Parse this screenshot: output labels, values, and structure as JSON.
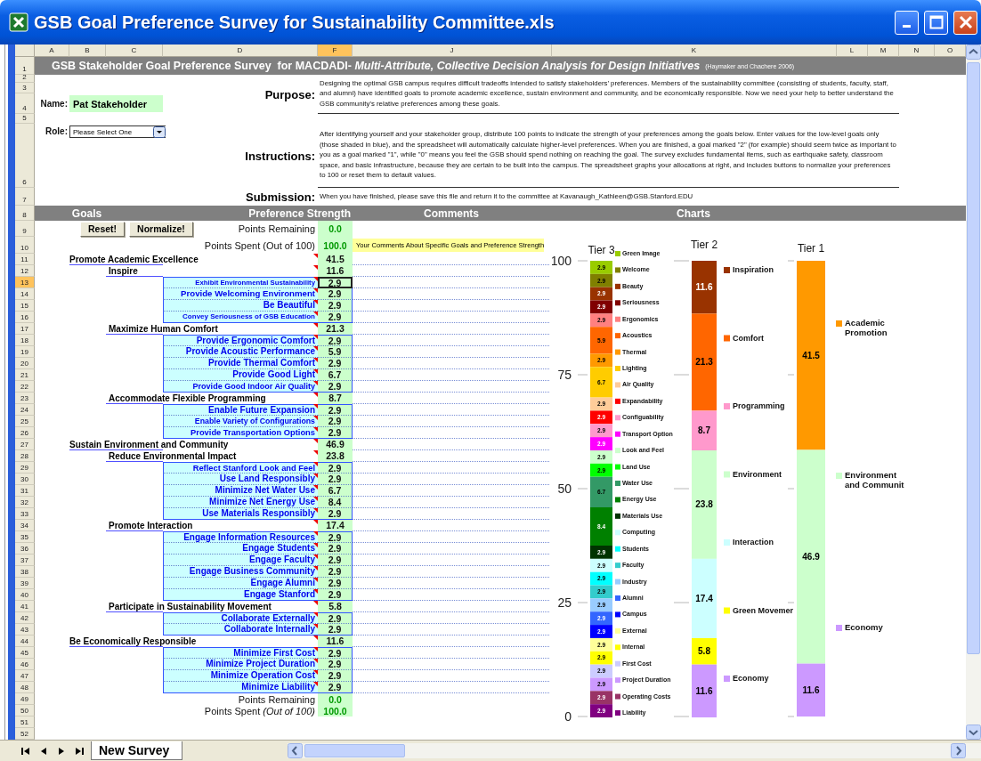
{
  "window": {
    "title": "GSB Goal Preference Survey for Sustainability Committee.xls"
  },
  "sheet": {
    "columns": [
      {
        "label": "A",
        "selected": false
      },
      {
        "label": "B",
        "selected": false
      },
      {
        "label": "C",
        "selected": false
      },
      {
        "label": "D",
        "selected": false
      },
      {
        "label": "F",
        "selected": true
      },
      {
        "label": "J",
        "selected": false
      },
      {
        "label": "K",
        "selected": false
      },
      {
        "label": "L",
        "selected": false
      },
      {
        "label": "M",
        "selected": false
      },
      {
        "label": "N",
        "selected": false
      },
      {
        "label": "O",
        "selected": false
      }
    ],
    "rows": [
      {
        "label": "1",
        "selected": false
      },
      {
        "label": "2",
        "selected": false
      },
      {
        "label": "3",
        "selected": false
      },
      {
        "label": "4",
        "selected": false
      },
      {
        "label": "5",
        "selected": false
      },
      {
        "label": "6",
        "selected": false
      },
      {
        "label": "7",
        "selected": false
      },
      {
        "label": "8",
        "selected": false
      },
      {
        "label": "9",
        "selected": false
      },
      {
        "label": "10",
        "selected": false
      },
      {
        "label": "11",
        "selected": false
      },
      {
        "label": "12",
        "selected": false
      },
      {
        "label": "13",
        "selected": true
      },
      {
        "label": "14",
        "selected": false
      },
      {
        "label": "15",
        "selected": false
      },
      {
        "label": "16",
        "selected": false
      },
      {
        "label": "17",
        "selected": false
      },
      {
        "label": "18",
        "selected": false
      },
      {
        "label": "19",
        "selected": false
      },
      {
        "label": "20",
        "selected": false
      },
      {
        "label": "21",
        "selected": false
      },
      {
        "label": "22",
        "selected": false
      },
      {
        "label": "23",
        "selected": false
      },
      {
        "label": "24",
        "selected": false
      },
      {
        "label": "25",
        "selected": false
      },
      {
        "label": "26",
        "selected": false
      },
      {
        "label": "27",
        "selected": false
      },
      {
        "label": "28",
        "selected": false
      },
      {
        "label": "29",
        "selected": false
      },
      {
        "label": "30",
        "selected": false
      },
      {
        "label": "31",
        "selected": false
      },
      {
        "label": "32",
        "selected": false
      },
      {
        "label": "33",
        "selected": false
      },
      {
        "label": "34",
        "selected": false
      },
      {
        "label": "35",
        "selected": false
      },
      {
        "label": "36",
        "selected": false
      },
      {
        "label": "37",
        "selected": false
      },
      {
        "label": "38",
        "selected": false
      },
      {
        "label": "39",
        "selected": false
      },
      {
        "label": "40",
        "selected": false
      },
      {
        "label": "41",
        "selected": false
      },
      {
        "label": "42",
        "selected": false
      },
      {
        "label": "43",
        "selected": false
      },
      {
        "label": "44",
        "selected": false
      },
      {
        "label": "45",
        "selected": false
      },
      {
        "label": "46",
        "selected": false
      },
      {
        "label": "47",
        "selected": false
      },
      {
        "label": "48",
        "selected": false
      },
      {
        "label": "49",
        "selected": false
      },
      {
        "label": "50",
        "selected": false
      },
      {
        "label": "51",
        "selected": false
      },
      {
        "label": "52",
        "selected": false
      }
    ],
    "tabs": [
      {
        "label": "New Survey",
        "selected": true
      }
    ]
  },
  "banner": {
    "title": "GSB Stakeholder Goal Preference Survey  for MACDADI- *Multi-Attribute, Collective Decision Analysis for Design Initiatives*",
    "citation": "(Haymaker and Chachere 2006)"
  },
  "name_field": {
    "label": "Name:",
    "value": "Pat Stakeholder"
  },
  "role_field": {
    "label": "Role:",
    "value": "Please Select One"
  },
  "intro": [
    {
      "label": "Purpose:",
      "text": "Designing the optimal GSB campus requires difficult tradeoffs intended to satisfy stakeholders’ preferences. Members of the sustainability committee (consisting of students, faculty, staff, and alumni) have identified goals to promote academic excellence, sustain environment and community, and be economically responsible. Now we need your help to better understand the GSB community’s relative preferences among these goals."
    },
    {
      "label": "Instructions:",
      "text": "After identifying yourself and your stakeholder group, distribute 100 points to indicate the strength of your preferences among the goals below. Enter values for the low-level goals only (those shaded in blue), and the spreadsheet will automatically calculate higher-level preferences. When you are finished, a goal marked \"2\" (for example) should seem twice as important to you as a goal marked \"1\", while \"0\" means you feel the GSB should spend nothing on reaching the goal. The survey excludes fundamental items, such as earthquake safety, classroom space, and basic infrastructure, because they are certain to be built into the campus. The spreadsheet graphs your allocations at right, and includes buttons to normalize your preferences to 100 or reset them to default values."
    },
    {
      "label": "Submission:",
      "text": "When you have finished, please save this file and return it to the committee at Kavanaugh_Kathleen@GSB.Stanford.EDU"
    }
  ],
  "section_headers": [
    "Goals",
    "Preference Strength",
    "Comments",
    "Charts"
  ],
  "buttons": [
    "Reset!",
    "Normalize!"
  ],
  "totals_top": [
    {
      "label": "Points Remaining",
      "value": "0.0"
    },
    {
      "label": "Points Spent (Out of 100)",
      "value": "100.0"
    }
  ],
  "comment_header": "Your Comments About Specific Goals and Preference Strength",
  "goals": [
    {
      "name": "Promote Academic Excellence",
      "value": "41.5",
      "children": [
        {
          "name": "Inspire",
          "value": "11.6",
          "children": [
            {
              "name": "Exhibit Environmental Sustainability",
              "value": "2.9",
              "selected": true
            },
            {
              "name": "Provide Welcoming Environment",
              "value": "2.9",
              "selected": false
            },
            {
              "name": "Be Beautiful",
              "value": "2.9",
              "selected": false
            },
            {
              "name": "Convey Seriousness of GSB Education",
              "value": "2.9",
              "selected": false
            }
          ]
        },
        {
          "name": "Maximize Human Comfort",
          "value": "21.3",
          "children": [
            {
              "name": "Provide Ergonomic Comfort",
              "value": "2.9",
              "selected": false
            },
            {
              "name": "Provide Acoustic Performance",
              "value": "5.9",
              "selected": false
            },
            {
              "name": "Provide Thermal Comfort",
              "value": "2.9",
              "selected": false
            },
            {
              "name": "Provide Good Light",
              "value": "6.7",
              "selected": false
            },
            {
              "name": "Provide Good Indoor Air Quality",
              "value": "2.9",
              "selected": false
            }
          ]
        },
        {
          "name": "Accommodate Flexible Programming",
          "value": "8.7",
          "children": [
            {
              "name": "Enable Future Expansion",
              "value": "2.9",
              "selected": false
            },
            {
              "name": "Enable Variety of Configurations",
              "value": "2.9",
              "selected": false
            },
            {
              "name": "Provide Transportation Options",
              "value": "2.9",
              "selected": false
            }
          ]
        }
      ]
    },
    {
      "name": "Sustain Environment and Community",
      "value": "46.9",
      "children": [
        {
          "name": "Reduce Environmental Impact",
          "value": "23.8",
          "children": [
            {
              "name": "Reflect Stanford Look and Feel",
              "value": "2.9",
              "selected": false
            },
            {
              "name": "Use Land Responsibly",
              "value": "2.9",
              "selected": false
            },
            {
              "name": "Minimize Net Water Use",
              "value": "6.7",
              "selected": false
            },
            {
              "name": "Minimize Net Energy Use",
              "value": "8.4",
              "selected": false
            },
            {
              "name": "Use Materials Responsibly",
              "value": "2.9",
              "selected": false
            }
          ]
        },
        {
          "name": "Promote Interaction",
          "value": "17.4",
          "children": [
            {
              "name": "Engage Information Resources",
              "value": "2.9",
              "selected": false
            },
            {
              "name": "Engage Students",
              "value": "2.9",
              "selected": false
            },
            {
              "name": "Engage Faculty",
              "value": "2.9",
              "selected": false
            },
            {
              "name": "Engage Business Community",
              "value": "2.9",
              "selected": false
            },
            {
              "name": "Engage Alumni",
              "value": "2.9",
              "selected": false
            },
            {
              "name": "Engage Stanford",
              "value": "2.9",
              "selected": false
            }
          ]
        },
        {
          "name": "Participate in Sustainability Movement",
          "value": "5.8",
          "children": [
            {
              "name": "Collaborate Externally",
              "value": "2.9",
              "selected": false
            },
            {
              "name": "Collaborate Internally",
              "value": "2.9",
              "selected": false
            }
          ]
        }
      ]
    },
    {
      "name": "Be Economically Responsible",
      "value": "11.6",
      "children": [
        {
          "name": "Minimize First Cost",
          "value": "2.9",
          "selected": false
        },
        {
          "name": "Minimize Project Duration",
          "value": "2.9",
          "selected": false
        },
        {
          "name": "Minimize Operation Cost",
          "value": "2.9",
          "selected": false
        },
        {
          "name": "Minimize Liability",
          "value": "2.9",
          "selected": false
        }
      ]
    }
  ],
  "totals_bottom": [
    {
      "label": "Points Remaining",
      "value": "0.0"
    },
    {
      "label": "Points Spent *(Out of 100)*",
      "value": "100.0"
    }
  ],
  "charts": {
    "chart_data": {
      "type": "bar",
      "stacked": true,
      "orientation": "vertical",
      "legend": true,
      "categories": [
        "Tier 3",
        "Tier 2",
        "Tier 1"
      ],
      "ylim": [
        0,
        100
      ],
      "yticks": [
        0,
        25,
        50,
        75,
        100
      ],
      "value_labels": [
        "2.9",
        "2.9",
        "2.9",
        "2.9",
        "2.9",
        "5.9",
        "2.9",
        "6.7",
        "2.9",
        "2.9",
        "2.9",
        "2.9",
        "2.9",
        "2.9",
        "6.7",
        "8.4",
        "2.9",
        "2.9",
        "2.9",
        "2.9",
        "2.9",
        "2.9",
        "2.9",
        "2.9",
        "2.9",
        "2.9",
        "2.9",
        "2.9",
        "2.9",
        "11.6",
        "21.3",
        "8.7",
        "23.8",
        "17.4",
        "5.8",
        "11.6",
        "41.5",
        "46.9",
        "11.6"
      ],
      "series": [
        {
          "name": "Green Image",
          "color": "#99cc00",
          "values": [
            2.9,
            null,
            null
          ]
        },
        {
          "name": "Welcome",
          "color": "#808000",
          "values": [
            2.9,
            null,
            null
          ]
        },
        {
          "name": "Beauty",
          "color": "#993300",
          "values": [
            2.9,
            null,
            null
          ]
        },
        {
          "name": "Seriousness",
          "color": "#800000",
          "values": [
            2.9,
            null,
            null
          ]
        },
        {
          "name": "Ergonomics",
          "color": "#ff8080",
          "values": [
            2.9,
            null,
            null
          ]
        },
        {
          "name": "Acoustics",
          "color": "#ff6600",
          "values": [
            5.9,
            null,
            null
          ]
        },
        {
          "name": "Thermal",
          "color": "#ff9900",
          "values": [
            2.9,
            null,
            null
          ]
        },
        {
          "name": "Lighting",
          "color": "#ffcc00",
          "values": [
            6.7,
            null,
            null
          ]
        },
        {
          "name": "Air Quality",
          "color": "#ffcc99",
          "values": [
            2.9,
            null,
            null
          ]
        },
        {
          "name": "Expandability",
          "color": "#ff0000",
          "values": [
            2.9,
            null,
            null
          ]
        },
        {
          "name": "Configuability",
          "color": "#ff99cc",
          "values": [
            2.9,
            null,
            null
          ]
        },
        {
          "name": "Transport Option",
          "color": "#ff00ff",
          "values": [
            2.9,
            null,
            null
          ]
        },
        {
          "name": "Look and Feel",
          "color": "#ccffcc",
          "values": [
            2.9,
            null,
            null
          ]
        },
        {
          "name": "Land Use",
          "color": "#00ff00",
          "values": [
            2.9,
            null,
            null
          ]
        },
        {
          "name": "Water Use",
          "color": "#339966",
          "values": [
            6.7,
            null,
            null
          ]
        },
        {
          "name": "Energy Use",
          "color": "#008000",
          "values": [
            8.4,
            null,
            null
          ]
        },
        {
          "name": "Materials Use",
          "color": "#003300",
          "values": [
            2.9,
            null,
            null
          ]
        },
        {
          "name": "Computing",
          "color": "#ccffff",
          "values": [
            2.9,
            null,
            null
          ]
        },
        {
          "name": "Students",
          "color": "#00ffff",
          "values": [
            2.9,
            null,
            null
          ]
        },
        {
          "name": "Faculty",
          "color": "#33cccc",
          "values": [
            2.9,
            null,
            null
          ]
        },
        {
          "name": "Industry",
          "color": "#99ccff",
          "values": [
            2.9,
            null,
            null
          ]
        },
        {
          "name": "Alumni",
          "color": "#3366ff",
          "values": [
            2.9,
            null,
            null
          ]
        },
        {
          "name": "Campus",
          "color": "#0000ff",
          "values": [
            2.9,
            null,
            null
          ]
        },
        {
          "name": "External",
          "color": "#ffff99",
          "values": [
            2.9,
            null,
            null
          ]
        },
        {
          "name": "Internal",
          "color": "#ffff00",
          "values": [
            2.9,
            null,
            null
          ]
        },
        {
          "name": "First Cost",
          "color": "#ccccff",
          "values": [
            2.9,
            null,
            null
          ]
        },
        {
          "name": "Project Duration",
          "color": "#cc99ff",
          "values": [
            2.9,
            null,
            null
          ]
        },
        {
          "name": "Operating Costs",
          "color": "#993366",
          "values": [
            2.9,
            null,
            null
          ]
        },
        {
          "name": "Liability",
          "color": "#800080",
          "values": [
            2.9,
            null,
            null
          ]
        },
        {
          "name": "Inspiration",
          "color": "#993300",
          "values": [
            null,
            11.6,
            null
          ]
        },
        {
          "name": "Comfort",
          "color": "#ff6600",
          "values": [
            null,
            21.3,
            null
          ]
        },
        {
          "name": "Programming",
          "color": "#ff99cc",
          "values": [
            null,
            8.7,
            null
          ]
        },
        {
          "name": "Environment",
          "color": "#ccffcc",
          "values": [
            null,
            23.8,
            null
          ]
        },
        {
          "name": "Interaction",
          "color": "#ccffff",
          "values": [
            null,
            17.4,
            null
          ]
        },
        {
          "name": "Green Movemer",
          "color": "#ffff00",
          "values": [
            null,
            5.8,
            null
          ]
        },
        {
          "name": "Economy",
          "color": "#cc99ff",
          "values": [
            null,
            11.6,
            null
          ]
        },
        {
          "name": "Academic Promotion",
          "color": "#ff9900",
          "values": [
            null,
            null,
            41.5
          ]
        },
        {
          "name": "Environment and Communit",
          "color": "#ccffcc",
          "values": [
            null,
            null,
            46.9
          ]
        },
        {
          "name": "Economy",
          "color": "#cc99ff",
          "values": [
            null,
            null,
            11.6
          ]
        }
      ]
    }
  }
}
